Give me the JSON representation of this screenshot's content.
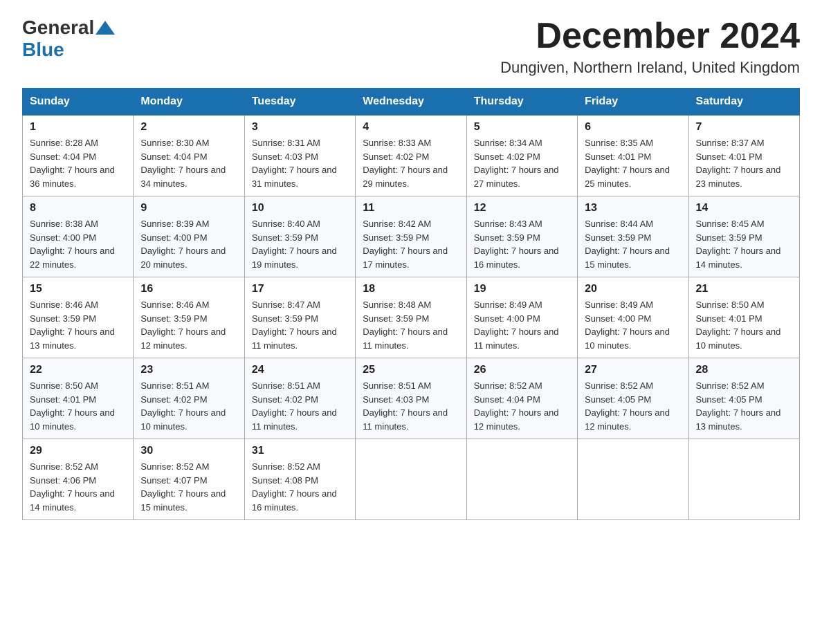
{
  "header": {
    "logo_general": "General",
    "logo_blue": "Blue",
    "month_title": "December 2024",
    "location": "Dungiven, Northern Ireland, United Kingdom"
  },
  "days_of_week": [
    "Sunday",
    "Monday",
    "Tuesday",
    "Wednesday",
    "Thursday",
    "Friday",
    "Saturday"
  ],
  "weeks": [
    [
      {
        "day": "1",
        "sunrise": "8:28 AM",
        "sunset": "4:04 PM",
        "daylight": "7 hours and 36 minutes."
      },
      {
        "day": "2",
        "sunrise": "8:30 AM",
        "sunset": "4:04 PM",
        "daylight": "7 hours and 34 minutes."
      },
      {
        "day": "3",
        "sunrise": "8:31 AM",
        "sunset": "4:03 PM",
        "daylight": "7 hours and 31 minutes."
      },
      {
        "day": "4",
        "sunrise": "8:33 AM",
        "sunset": "4:02 PM",
        "daylight": "7 hours and 29 minutes."
      },
      {
        "day": "5",
        "sunrise": "8:34 AM",
        "sunset": "4:02 PM",
        "daylight": "7 hours and 27 minutes."
      },
      {
        "day": "6",
        "sunrise": "8:35 AM",
        "sunset": "4:01 PM",
        "daylight": "7 hours and 25 minutes."
      },
      {
        "day": "7",
        "sunrise": "8:37 AM",
        "sunset": "4:01 PM",
        "daylight": "7 hours and 23 minutes."
      }
    ],
    [
      {
        "day": "8",
        "sunrise": "8:38 AM",
        "sunset": "4:00 PM",
        "daylight": "7 hours and 22 minutes."
      },
      {
        "day": "9",
        "sunrise": "8:39 AM",
        "sunset": "4:00 PM",
        "daylight": "7 hours and 20 minutes."
      },
      {
        "day": "10",
        "sunrise": "8:40 AM",
        "sunset": "3:59 PM",
        "daylight": "7 hours and 19 minutes."
      },
      {
        "day": "11",
        "sunrise": "8:42 AM",
        "sunset": "3:59 PM",
        "daylight": "7 hours and 17 minutes."
      },
      {
        "day": "12",
        "sunrise": "8:43 AM",
        "sunset": "3:59 PM",
        "daylight": "7 hours and 16 minutes."
      },
      {
        "day": "13",
        "sunrise": "8:44 AM",
        "sunset": "3:59 PM",
        "daylight": "7 hours and 15 minutes."
      },
      {
        "day": "14",
        "sunrise": "8:45 AM",
        "sunset": "3:59 PM",
        "daylight": "7 hours and 14 minutes."
      }
    ],
    [
      {
        "day": "15",
        "sunrise": "8:46 AM",
        "sunset": "3:59 PM",
        "daylight": "7 hours and 13 minutes."
      },
      {
        "day": "16",
        "sunrise": "8:46 AM",
        "sunset": "3:59 PM",
        "daylight": "7 hours and 12 minutes."
      },
      {
        "day": "17",
        "sunrise": "8:47 AM",
        "sunset": "3:59 PM",
        "daylight": "7 hours and 11 minutes."
      },
      {
        "day": "18",
        "sunrise": "8:48 AM",
        "sunset": "3:59 PM",
        "daylight": "7 hours and 11 minutes."
      },
      {
        "day": "19",
        "sunrise": "8:49 AM",
        "sunset": "4:00 PM",
        "daylight": "7 hours and 11 minutes."
      },
      {
        "day": "20",
        "sunrise": "8:49 AM",
        "sunset": "4:00 PM",
        "daylight": "7 hours and 10 minutes."
      },
      {
        "day": "21",
        "sunrise": "8:50 AM",
        "sunset": "4:01 PM",
        "daylight": "7 hours and 10 minutes."
      }
    ],
    [
      {
        "day": "22",
        "sunrise": "8:50 AM",
        "sunset": "4:01 PM",
        "daylight": "7 hours and 10 minutes."
      },
      {
        "day": "23",
        "sunrise": "8:51 AM",
        "sunset": "4:02 PM",
        "daylight": "7 hours and 10 minutes."
      },
      {
        "day": "24",
        "sunrise": "8:51 AM",
        "sunset": "4:02 PM",
        "daylight": "7 hours and 11 minutes."
      },
      {
        "day": "25",
        "sunrise": "8:51 AM",
        "sunset": "4:03 PM",
        "daylight": "7 hours and 11 minutes."
      },
      {
        "day": "26",
        "sunrise": "8:52 AM",
        "sunset": "4:04 PM",
        "daylight": "7 hours and 12 minutes."
      },
      {
        "day": "27",
        "sunrise": "8:52 AM",
        "sunset": "4:05 PM",
        "daylight": "7 hours and 12 minutes."
      },
      {
        "day": "28",
        "sunrise": "8:52 AM",
        "sunset": "4:05 PM",
        "daylight": "7 hours and 13 minutes."
      }
    ],
    [
      {
        "day": "29",
        "sunrise": "8:52 AM",
        "sunset": "4:06 PM",
        "daylight": "7 hours and 14 minutes."
      },
      {
        "day": "30",
        "sunrise": "8:52 AM",
        "sunset": "4:07 PM",
        "daylight": "7 hours and 15 minutes."
      },
      {
        "day": "31",
        "sunrise": "8:52 AM",
        "sunset": "4:08 PM",
        "daylight": "7 hours and 16 minutes."
      },
      null,
      null,
      null,
      null
    ]
  ]
}
